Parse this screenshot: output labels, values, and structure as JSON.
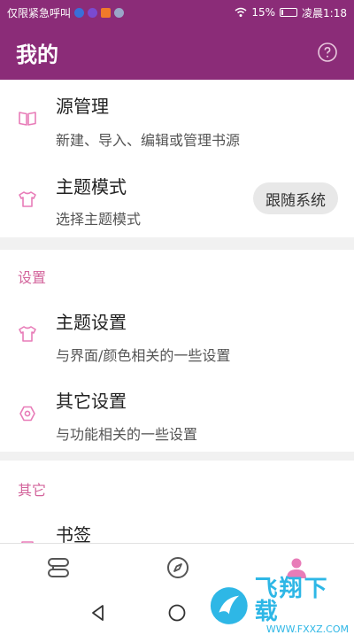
{
  "status_bar": {
    "left_text": "仅限紧急呼叫",
    "battery": "15%",
    "time": "凌晨1:18",
    "battery_level": 0.15
  },
  "app_bar": {
    "title": "我的",
    "help_icon": "help-circle-icon"
  },
  "top_section": {
    "items": [
      {
        "title": "源管理",
        "subtitle": "新建、导入、编辑或管理书源",
        "icon": "book-icon"
      },
      {
        "title": "主题模式",
        "subtitle": "选择主题模式",
        "icon": "tshirt-icon",
        "chip": "跟随系统"
      }
    ]
  },
  "settings_section": {
    "label": "设置",
    "items": [
      {
        "title": "主题设置",
        "subtitle": "与界面/颜色相关的一些设置",
        "icon": "tshirt-icon"
      },
      {
        "title": "其它设置",
        "subtitle": "与功能相关的一些设置",
        "icon": "hexagon-gear-icon"
      }
    ]
  },
  "other_section": {
    "label": "其它",
    "items": [
      {
        "title": "书签",
        "icon": "bookmark-icon"
      }
    ]
  },
  "bottom_nav": {
    "items": [
      {
        "name": "bookshelf-nav-icon",
        "active": false
      },
      {
        "name": "compass-nav-icon",
        "active": false
      },
      {
        "name": "person-nav-icon",
        "active": true
      }
    ]
  },
  "colors": {
    "primary": "#8b2c78",
    "accent": "#e87cb8",
    "group_label": "#d3659c"
  },
  "watermark": {
    "brand": "飞翔下载",
    "url": "WWW.FXXZ.COM"
  }
}
